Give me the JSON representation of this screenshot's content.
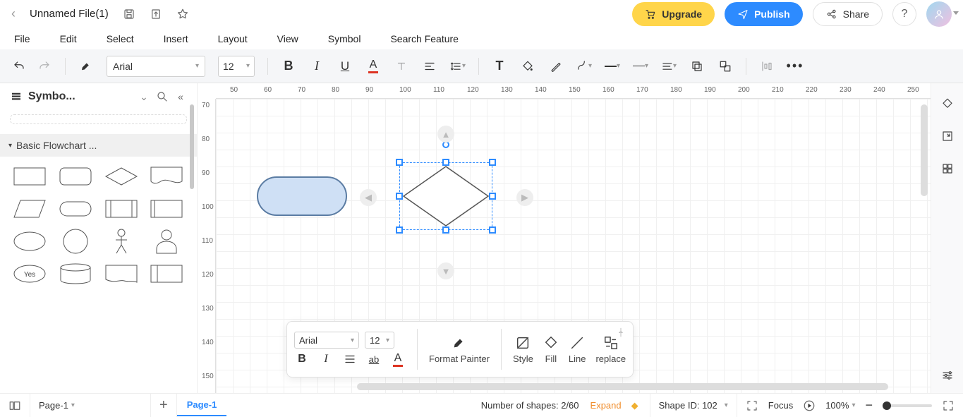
{
  "title": "Unnamed File(1)",
  "menus": [
    "File",
    "Edit",
    "Select",
    "Insert",
    "Layout",
    "View",
    "Symbol",
    "Search Feature"
  ],
  "actions": {
    "upgrade": "Upgrade",
    "publish": "Publish",
    "share": "Share"
  },
  "toolbar": {
    "font": "Arial",
    "size": "12"
  },
  "sidebar": {
    "title": "Symbo...",
    "category": "Basic Flowchart ..."
  },
  "rulerH": [
    "50",
    "60",
    "70",
    "80",
    "90",
    "100",
    "110",
    "120",
    "130",
    "140",
    "150",
    "160",
    "170",
    "180",
    "190",
    "200",
    "210",
    "220",
    "230",
    "240",
    "250"
  ],
  "rulerV": [
    "70",
    "80",
    "90",
    "100",
    "110",
    "120",
    "130",
    "140",
    "150"
  ],
  "float": {
    "font": "Arial",
    "size": "12",
    "formatPainter": "Format Painter",
    "style": "Style",
    "fill": "Fill",
    "line": "Line",
    "replace": "replace"
  },
  "pages": {
    "selector": "Page-1",
    "active": "Page-1"
  },
  "status": {
    "shapesLabel": "Number of shapes: ",
    "shapesCount": "2/60",
    "expand": "Expand",
    "shapeIdLabel": "Shape ID: ",
    "shapeId": "102",
    "focus": "Focus",
    "zoom": "100%"
  },
  "shapeLib": {
    "yes": "Yes"
  }
}
